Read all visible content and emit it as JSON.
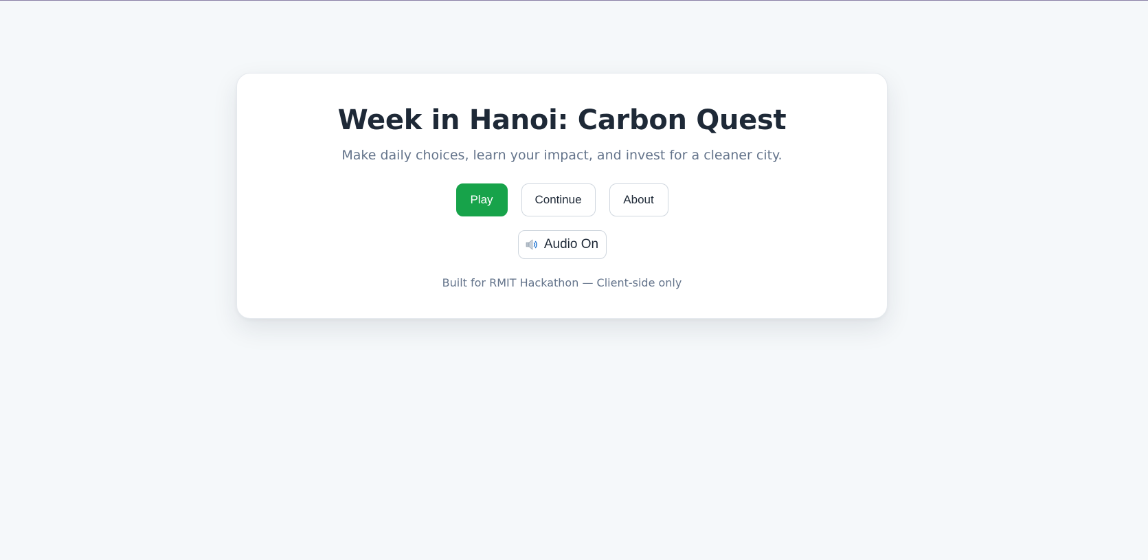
{
  "menu": {
    "title": "Week in Hanoi: Carbon Quest",
    "subtitle": "Make daily choices, learn your impact, and invest for a cleaner city.",
    "buttons": {
      "play": "Play",
      "continue": "Continue",
      "about": "About"
    },
    "audio": {
      "icon": "speaker-icon",
      "label": "Audio On"
    },
    "footer": "Built for RMIT Hackathon — Client-side only"
  },
  "colors": {
    "background": "#f5f8fa",
    "card": "#ffffff",
    "primary": "#17a34a",
    "title": "#1e2937",
    "muted": "#64748b",
    "border": "#cfd6de"
  }
}
